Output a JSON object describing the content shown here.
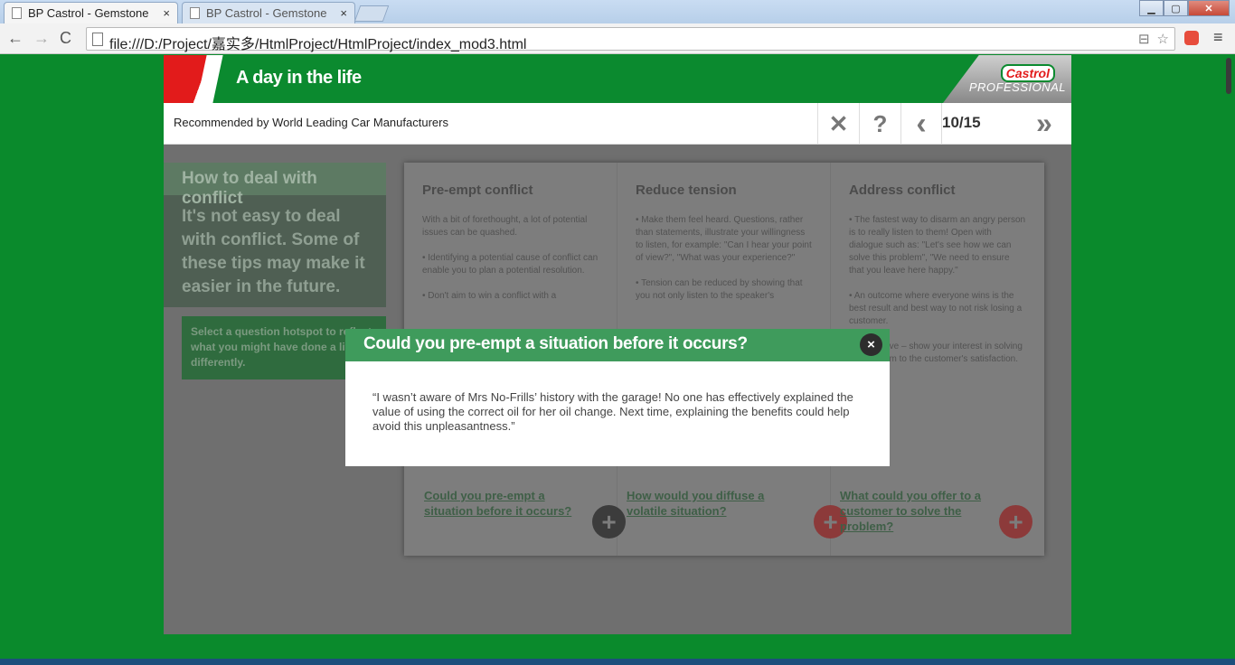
{
  "browser": {
    "tabs": [
      {
        "title": "BP Castrol - Gemstone",
        "close": "×"
      },
      {
        "title": "BP Castrol - Gemstone",
        "close": "×"
      }
    ],
    "window_buttons": {
      "minimize": "▁",
      "maximize": "▢",
      "close": "✕"
    },
    "nav": {
      "back": "←",
      "forward": "→",
      "reload": "C"
    },
    "url": "file:///D:/Project/嘉实多/HtmlProject/HtmlProject/index_mod3.html",
    "omnibox_icons": {
      "translate": "⊟",
      "star": "☆"
    },
    "menu": "≡"
  },
  "course": {
    "title": "A day in the life",
    "logo": {
      "brand": "Castrol",
      "sub": "PROFESSIONAL"
    },
    "subtitle": "Recommended by World Leading Car Manufacturers",
    "controls": {
      "close": "✕",
      "help": "?",
      "prev": "‹",
      "next": "»"
    },
    "page_counter": "10/15",
    "intro": {
      "heading": "How to deal with conflict",
      "body": "It's not easy to deal with conflict. Some of these tips may make it easier in the future.",
      "hint": "Select a question hotspot to reflect what you might have done a little differently."
    },
    "columns": [
      {
        "title": "Pre-empt conflict",
        "paragraphs": [
          "With a bit of forethought, a lot of potential issues can be quashed.",
          "• Identifying a potential cause of conflict can enable you to plan a potential resolution.",
          "• Don't aim to win a conflict with a"
        ],
        "link": "Could you pre-empt a situation before it occurs?",
        "plus": "+"
      },
      {
        "title": "Reduce tension",
        "paragraphs": [
          "• Make them feel heard. Questions, rather than statements, illustrate your willingness to listen, for example: \"Can I hear your point of view?\", \"What was your experience?\"",
          "• Tension can be reduced by showing that you not only listen to the speaker's"
        ],
        "link": "How would you diffuse a volatile situation?",
        "plus": "+"
      },
      {
        "title": "Address conflict",
        "paragraphs": [
          "• The fastest way to disarm an angry person is to really listen to them! Open with dialogue such as: \"Let's see how we can solve this problem\", \"We need to ensure that you leave here happy.\"",
          "• An outcome where everyone wins is the best result and best way to not risk losing a customer.",
          "• Be positive – show your interest in solving the problem to the customer's satisfaction."
        ],
        "link": "What could you offer to a customer to solve the problem?",
        "plus": "+"
      }
    ]
  },
  "modal": {
    "title": "Could you pre-empt a situation before it occurs?",
    "close": "×",
    "text": "“I wasn’t aware of Mrs No-Frills’ history with the garage! No one has effectively explained the value of using the correct oil for her oil change. Next time, explaining the benefits could help avoid this unpleasantness.”"
  }
}
